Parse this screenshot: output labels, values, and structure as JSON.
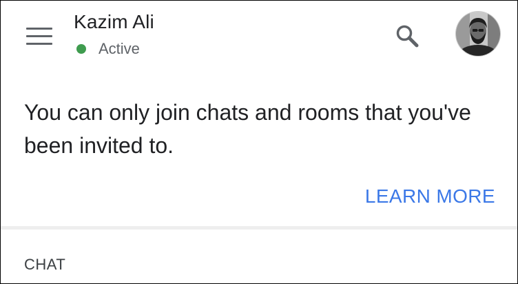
{
  "header": {
    "user_name": "Kazim Ali",
    "status": "Active",
    "status_color": "#3f9c4f",
    "menu_icon": "hamburger-menu-icon",
    "search_icon": "search-icon",
    "avatar": "user-avatar"
  },
  "notice": {
    "message": "You can only join chats and rooms that you've been invited to.",
    "action_label": "LEARN MORE",
    "action_color": "#3b78e7"
  },
  "sections": {
    "chat_label": "CHAT"
  }
}
